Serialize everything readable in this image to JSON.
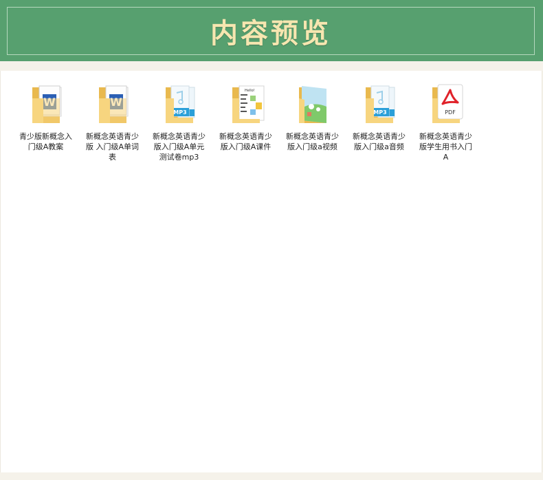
{
  "banner": {
    "title": "内容预览"
  },
  "files": [
    {
      "name": "青少版新概念入门级A教案",
      "icon": "word-folder-icon"
    },
    {
      "name": "新概念英语青少版 入门级A单词表",
      "icon": "word-folder-icon"
    },
    {
      "name": "新概念英语青少版入门级A单元测试卷mp3",
      "icon": "audio-folder-icon"
    },
    {
      "name": "新概念英语青少版入门级A课件",
      "icon": "slides-folder-icon"
    },
    {
      "name": "新概念英语青少版入门级a视频",
      "icon": "video-folder-icon"
    },
    {
      "name": "新概念英语青少版入门级a音频",
      "icon": "audio-folder-icon"
    },
    {
      "name": "新概念英语青少版学生用书入门A",
      "icon": "pdf-folder-icon"
    }
  ],
  "icon_text": {
    "mp3": "MP3",
    "pdf": "PDF",
    "word": "W",
    "slide_heading": "Hello!"
  },
  "colors": {
    "banner": "#57a06f",
    "banner_title": "#f6e6b0",
    "folder": "#f7d57f",
    "word": "#2b5fb4",
    "mp3": "#2a9fd8",
    "pdf": "#e0222a"
  }
}
